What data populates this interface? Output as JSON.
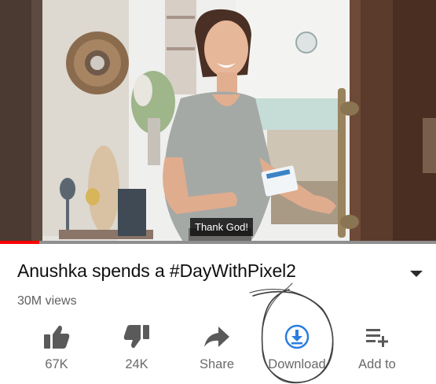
{
  "video": {
    "subtitle": "Thank God!",
    "progress_fraction": 0.09,
    "progress_color": "#ff0000"
  },
  "info": {
    "title": "Anushka spends a #DayWithPixel2",
    "views": "30M views",
    "expand_icon": "chevron-down-icon"
  },
  "actions": [
    {
      "icon": "thumbs-up-icon",
      "label": "67K"
    },
    {
      "icon": "thumbs-down-icon",
      "label": "24K"
    },
    {
      "icon": "share-icon",
      "label": "Share"
    },
    {
      "icon": "download-icon",
      "label": "Download",
      "accent": "#2a7de1"
    },
    {
      "icon": "add-to-playlist-icon",
      "label": "Add to"
    }
  ],
  "annotation": {
    "shape": "hand-drawn-circle",
    "color": "#3a3a3a"
  }
}
